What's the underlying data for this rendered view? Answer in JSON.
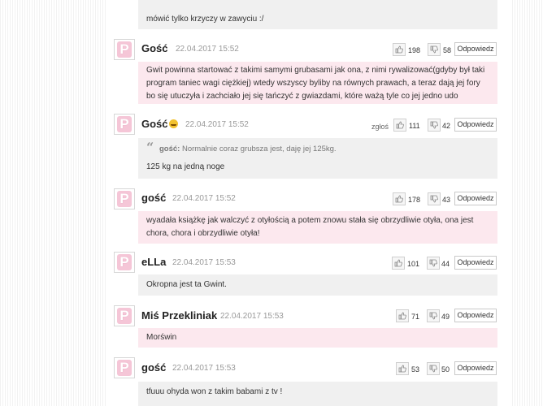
{
  "actions": {
    "reply_label": "Odpowiedz",
    "report_label": "zgłoś"
  },
  "top_fragment": {
    "text": "mówić tylko krzyczy w zawyciu :/"
  },
  "comments": [
    {
      "author": "Gość",
      "date": "22.04.2017 15:52",
      "likes": "198",
      "dislikes": "58",
      "text": "Gwit powinna startować z takimi samymi grubasami jak ona, z nimi rywalizować(gdyby był taki program taniec wagi ciężkiej) wtedy wszyscy byliby na równych prawach, a teraz dają jej fory bo się utuczyła i zachciało jej się tańczyć z gwiazdami, które ważą tyle co jej jedno udo"
    },
    {
      "author": "Gość",
      "date": "22.04.2017 15:52",
      "likes": "111",
      "dislikes": "42",
      "quote_author": "gość:",
      "quote_text": "Normalnie coraz grubsza jest, daję jej 125kg.",
      "text": "125 kg na jedną noge"
    },
    {
      "author": "gość",
      "date": "22.04.2017 15:52",
      "likes": "178",
      "dislikes": "43",
      "text": "wyadała książkę jak walczyć z otyłością a potem znowu stała się obrzydliwie otyła, ona jest chora, chora i obrzydliwie otyła!"
    },
    {
      "author": "eLLa",
      "date": "22.04.2017 15:53",
      "likes": "101",
      "dislikes": "44",
      "text": "Okropna jest ta Gwint."
    },
    {
      "author": "Miś Przekliniak",
      "date": "22.04.2017 15:53",
      "likes": "71",
      "dislikes": "49",
      "text": "Morświn"
    },
    {
      "author": "gość",
      "date": "22.04.2017 15:53",
      "likes": "53",
      "dislikes": "50",
      "text": "tfuuu ohyda won z takim babami z tv !"
    }
  ],
  "colors": {
    "pink_body": "#fce8ee",
    "grey_body": "#f0f0f0",
    "avatar_pink": "#f5c6d7"
  },
  "icons": {
    "avatar": "letter-p-avatar-icon",
    "like": "thumbs-up-icon",
    "dislike": "thumbs-down-icon",
    "quote": "quote-mark-icon"
  }
}
